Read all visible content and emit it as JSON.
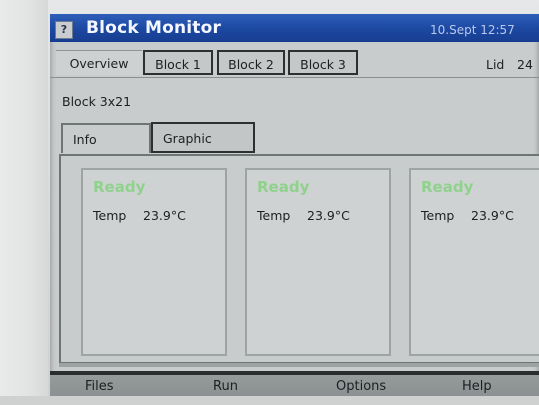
{
  "titlebar": {
    "help_glyph": "?",
    "title": "Block Monitor",
    "datetime": "10.Sept 12:57"
  },
  "tabs": [
    {
      "label": "Overview",
      "active": true
    },
    {
      "label": "Block 1",
      "active": false
    },
    {
      "label": "Block 2",
      "active": false
    },
    {
      "label": "Block 3",
      "active": false
    }
  ],
  "lid": {
    "label": "Lid",
    "value": "24"
  },
  "block_label": "Block 3x21",
  "inner_tabs": [
    {
      "label": "Info",
      "active": true
    },
    {
      "label": "Graphic",
      "active": false
    }
  ],
  "cards": [
    {
      "status": "Ready",
      "temp_label": "Temp",
      "temp_value": "23.9°C"
    },
    {
      "status": "Ready",
      "temp_label": "Temp",
      "temp_value": "23.9°C"
    },
    {
      "status": "Ready",
      "temp_label": "Temp",
      "temp_value": "23.9°C"
    }
  ],
  "menu": [
    {
      "label": "Files"
    },
    {
      "label": "Run"
    },
    {
      "label": "Options"
    },
    {
      "label": "Help"
    }
  ],
  "colors": {
    "titlebar": "#1d49a3",
    "ready_status": "#8fd28c",
    "screen_bg": "#c8cccc",
    "menubar": "#8a8f90"
  }
}
